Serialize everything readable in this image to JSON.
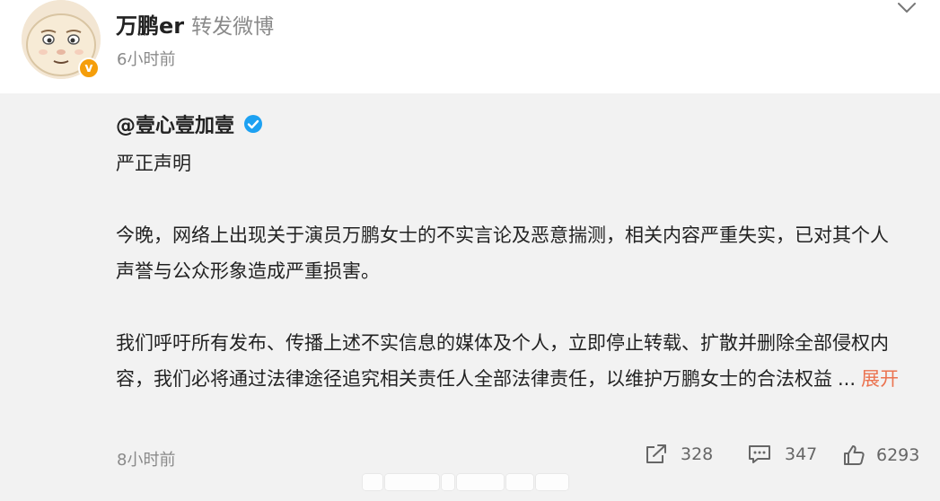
{
  "header": {
    "user_name": "万鹏er",
    "action": "转发微博",
    "time": "6小时前",
    "badge": "v"
  },
  "repost": {
    "author": "@壹心壹加壹",
    "title": "严正声明",
    "paragraph1": "今晚，网络上出现关于演员万鹏女士的不实言论及恶意揣测，相关内容严重失实，已对其个人声誉与公众形象造成严重损害。",
    "paragraph2": "我们呼吁所有发布、传播上述不实信息的媒体及个人，立即停止转载、扩散并删除全部侵权内容，我们必将通过法律途径追究相关责任人全部法律责任，以维护万鹏女士的合法权益",
    "ellipsis": "...",
    "expand_label": "展开",
    "time": "8小时前"
  },
  "stats": {
    "share": "328",
    "comment": "347",
    "like": "6293"
  },
  "icons": {
    "verified_badge": "orange-verified-badge",
    "blue_verified": "blue-verified-icon",
    "share": "share-icon",
    "comment": "comment-icon",
    "like": "thumbs-up-icon",
    "menu": "chevron-down-icon"
  },
  "colors": {
    "accent": "#eb7350",
    "badge": "#f59e0b",
    "blue_v": "#1da1f2",
    "repost_bg": "#f2f2f2"
  }
}
